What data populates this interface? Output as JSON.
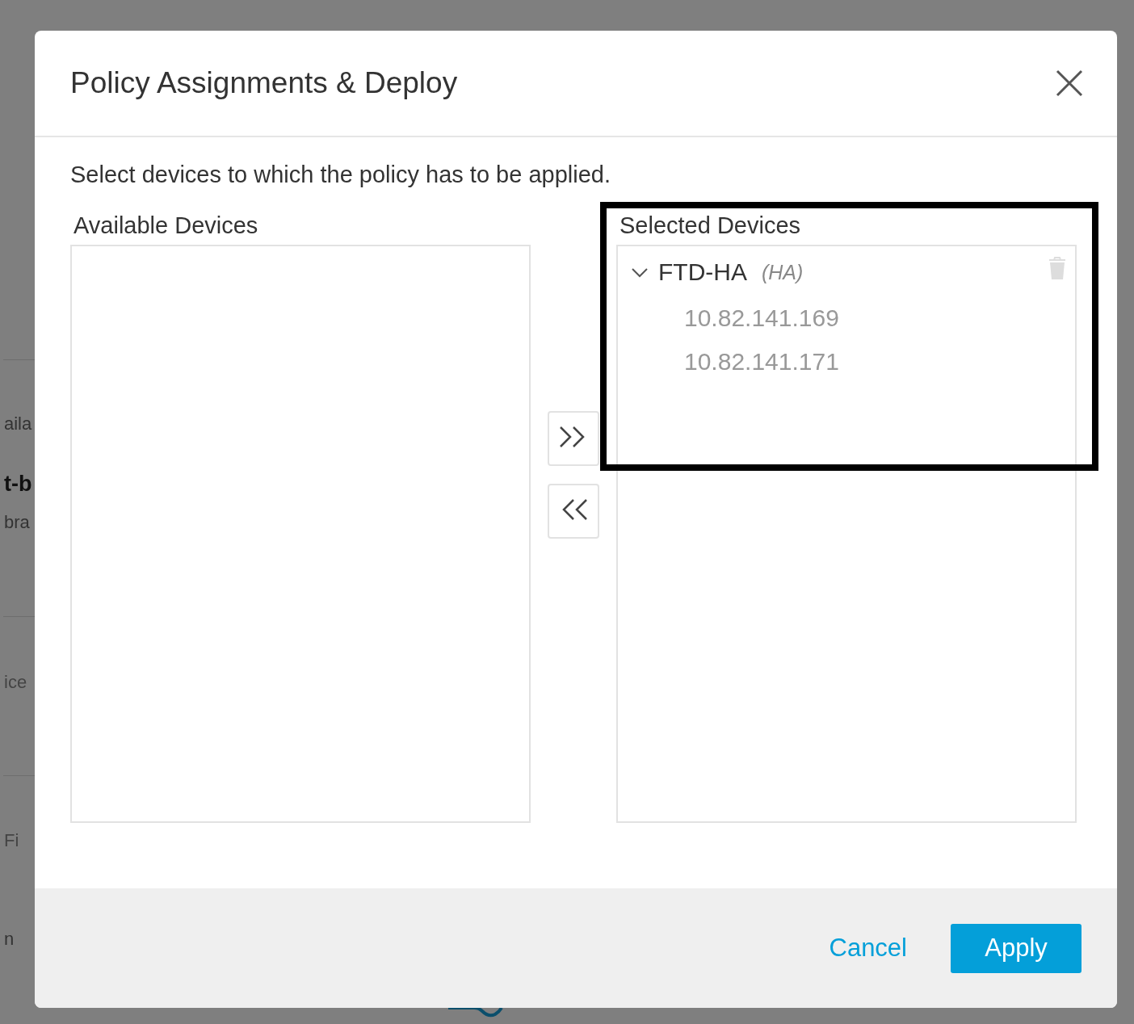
{
  "background": {
    "fragments": [
      "aila",
      "t-b",
      "bra",
      "ice",
      "Fi",
      "n"
    ]
  },
  "dialog": {
    "title": "Policy Assignments & Deploy",
    "instruction": "Select devices to which the policy has to be applied.",
    "available": {
      "label": "Available Devices"
    },
    "selected": {
      "label": "Selected Devices",
      "items": [
        {
          "name": "FTD-HA",
          "tag": "(HA)",
          "expanded": true,
          "children": [
            {
              "name": "10.82.141.169"
            },
            {
              "name": "10.82.141.171"
            }
          ]
        }
      ]
    },
    "move_buttons": [
      {
        "kind": "add"
      },
      {
        "kind": "remove"
      }
    ],
    "footer": {
      "cancel": "Cancel",
      "apply": "Apply"
    }
  }
}
